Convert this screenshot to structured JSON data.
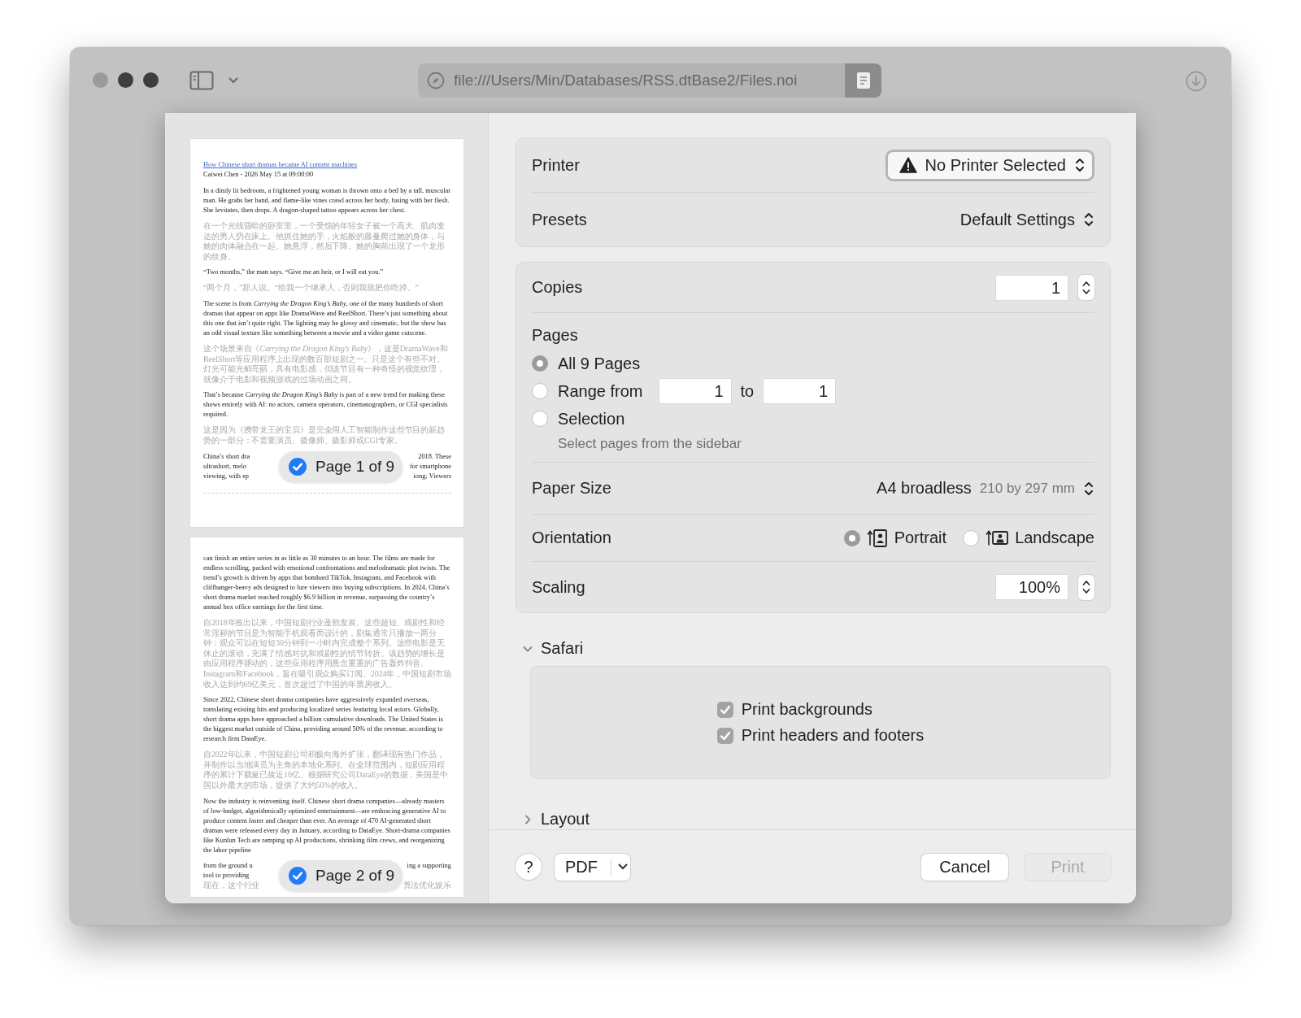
{
  "toolbar": {
    "url": "file:///Users/Min/Databases/RSS.dtBase2/Files.noi"
  },
  "preview": {
    "pages": [
      {
        "badge": "Page 1 of 9",
        "selected": true,
        "blocks": [
          {
            "kind": "link",
            "text": "How Chinese short dramas became AI content machines"
          },
          {
            "kind": "byline",
            "text": "Caiwei Chen - 2026 May 15 at 09:00:00"
          },
          {
            "kind": "en",
            "text": "In a dimly lit bedroom, a frightened young woman is thrown onto a bed by a tall, muscular man. He grabs her hand, and flame-like vines crawl across her body, fusing with her flesh. She levitates, then drops. A dragon-shaped tattoo appears across her chest."
          },
          {
            "kind": "zh",
            "text": "在一个光线昏暗的卧室里，一个受惊的年轻女子被一个高大、肌肉发达的男人扔在床上。他抓住她的手，火焰般的藤蔓爬过她的身体，与她的肉体融合在一起。她悬浮，然后下降。她的胸前出现了一个龙形的纹身。"
          },
          {
            "kind": "en",
            "text": "“Two months,” the man says. “Give me an heir, or I will eat you.”"
          },
          {
            "kind": "zh",
            "text": "“两个月，”那人说。“给我一个继承人，否则我就把你吃掉。”"
          },
          {
            "kind": "en",
            "text": "The scene is from *Carrying the Dragon King’s Baby*, one of the many hundreds of short dramas that appear on apps like DramaWave and ReelShort. There’s just something about this one that isn’t quite right. The lighting may be glossy and cinematic, but the show has an odd visual texture like something between a movie and a video game cutscene."
          },
          {
            "kind": "zh",
            "text": "这个场景来自《*Carrying the Dragon King’s Baby*》，这是DramaWave和ReelShort等应用程序上出现的数百部短剧之一。只是这个有些不对。灯光可能光鲜亮丽，具有电影感，但该节目有一种奇怪的视觉纹理，就像介于电影和视频游戏的过场动画之间。"
          },
          {
            "kind": "en",
            "text": "That’s because *Carrying the Dragon King’s Baby* is part of a new trend for making these shows entirely with AI: no actors, camera operators, cinematographers, or CGI specialists required."
          },
          {
            "kind": "zh",
            "text": "这是因为《携带龙王的宝贝》是完全用人工智能制作这些节目的新趋势的一部分：不需要演员、摄像师、摄影师或CGI专家。"
          },
          {
            "kind": "split",
            "lines": [
              {
                "kind": "en",
                "left": "China’s short dra",
                "right": "2018. These"
              },
              {
                "kind": "en",
                "left": "ultrashort, melo",
                "right": "for smartphone"
              },
              {
                "kind": "en",
                "left": "viewing, with ep",
                "right": "iong; Viewers"
              }
            ]
          }
        ]
      },
      {
        "badge": "Page 2 of 9",
        "selected": true,
        "blocks": [
          {
            "kind": "en",
            "text": "can finish an entire series in as little as 30 minutes to an hour. The films are made for endless scrolling, packed with emotional confrontations and melodramatic plot twists. The trend’s growth is driven by apps that bombard TikTok, Instagram, and Facebook with cliffhanger-heavy ads designed to lure viewers into buying subscriptions. In 2024, China’s short drama market reached roughly $6.9 billion in revenue, surpassing the country’s annual box office earnings for the first time."
          },
          {
            "kind": "zh",
            "text": "自2018年推出以来，中国短剧行业蓬勃发展。这些超短、戏剧性和经常淫秽的节目是为智能手机观看而设计的，剧集通常只播放一两分钟：观众可以在短短30分钟到一小时内完成整个系列。这些电影是无休止的滚动，充满了情感对抗和戏剧性的情节转折。该趋势的增长是由应用程序驱动的，这些应用程序用悬念重重的广告轰炸抖音、Instagram和Facebook，旨在吸引观众购买订阅。2024年，中国短剧市场收入达到约69亿美元，首次超过了中国的年票房收入。"
          },
          {
            "kind": "en",
            "text": "Since 2022, Chinese short drama companies have aggressively expanded overseas, translating existing hits and producing localized series featuring local actors. Globally, short drama apps have approached a billion cumulative downloads. The United States is the biggest market outside of China, providing around 50% of the revenue, according to research firm DataEye."
          },
          {
            "kind": "zh",
            "text": "自2022年以来，中国短剧公司积极向海外扩张，翻译现有热门作品，并制作以当地演员为主角的本地化系列。在全球范围内，短剧应用程序的累计下载量已接近10亿。根据研究公司DataEye的数据，美国是中国以外最大的市场，提供了大约50%的收入。"
          },
          {
            "kind": "en",
            "text": "Now the industry is reinventing itself. Chinese short drama companies—already masters of low-budget, algorithmically optimized entertainment—are embracing generative AI to produce content faster and cheaper than ever. An average of 470 AI-generated short dramas were released every day in January, according to DataEye. Short-drama companies like Kunlun Tech are ramping up AI productions, shrinking film crews, and reorganizing the labor pipeline"
          },
          {
            "kind": "split",
            "lines": [
              {
                "kind": "en",
                "left": "from the ground u",
                "right": "ing a supporting"
              },
              {
                "kind": "en",
                "left": "tool to providing"
              },
              {
                "kind": "zh",
                "left": "现在，这个行业",
                "right": "算法优化娱乐"
              }
            ]
          }
        ]
      }
    ]
  },
  "printer": {
    "label": "Printer",
    "value": "No Printer Selected"
  },
  "presets": {
    "label": "Presets",
    "value": "Default Settings"
  },
  "copies": {
    "label": "Copies",
    "value": "1"
  },
  "pages": {
    "label": "Pages",
    "options": [
      {
        "label": "All 9 Pages",
        "selected": true
      },
      {
        "label": "Range from",
        "from": "1",
        "to_label": "to",
        "to": "1",
        "selected": false
      },
      {
        "label": "Selection",
        "hint": "Select pages from the sidebar",
        "selected": false
      }
    ]
  },
  "paper_size": {
    "label": "Paper Size",
    "value": "A4 broadless",
    "detail": "210 by 297 mm"
  },
  "orientation": {
    "label": "Orientation",
    "options": [
      {
        "kind": "portrait",
        "label": "Portrait",
        "selected": true
      },
      {
        "kind": "landscape",
        "label": "Landscape",
        "selected": false
      }
    ]
  },
  "scaling": {
    "label": "Scaling",
    "value": "100%"
  },
  "sections": [
    {
      "title": "Safari",
      "expanded": true,
      "checkboxes": [
        {
          "label": "Print backgrounds",
          "checked": true
        },
        {
          "label": "Print headers and footers",
          "checked": true
        }
      ]
    },
    {
      "title": "Layout",
      "expanded": false
    }
  ],
  "footer": {
    "help": "?",
    "pdf": "PDF",
    "cancel": "Cancel",
    "print": {
      "label": "Print",
      "disabled": true
    }
  }
}
